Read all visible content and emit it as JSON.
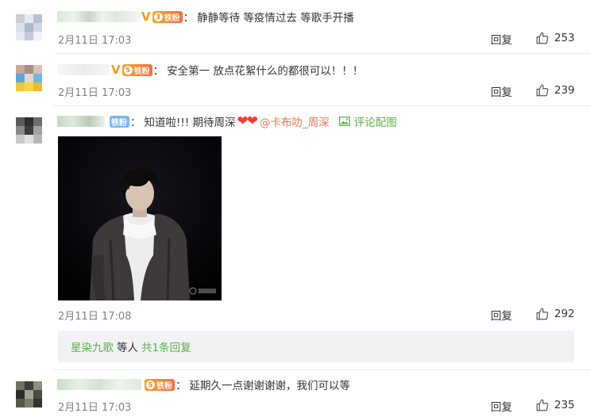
{
  "comments": [
    {
      "text": "静静等待 等疫情过去 等歌手开播",
      "date": "2月11日 17:03",
      "reply": "回复",
      "likes": "253",
      "fan_badge": "铁粉",
      "fan_level": "3"
    },
    {
      "text": "安全第一  放点花絮什么的都很可以！！！",
      "date": "2月11日 17:03",
      "reply": "回复",
      "likes": "239",
      "fan_badge": "铁粉",
      "fan_level": "5"
    },
    {
      "text": "知道啦!!!  期待周深",
      "mention": "@卡布叻_周深",
      "pic_link": "评论配图",
      "date": "2月11日 17:08",
      "reply": "回复",
      "likes": "292",
      "fan_badge": "铁粉",
      "sub_replies": {
        "name": "星染九歌",
        "others": "等人",
        "count": "共1条回复"
      }
    },
    {
      "text": "延期久一点谢谢谢谢，我们可以等",
      "date": "2月11日 17:03",
      "reply": "回复",
      "likes": "235",
      "fan_badge": "铁粉",
      "fan_level": "5"
    }
  ],
  "icons": {
    "like": "thumbs-up-icon",
    "picture": "picture-icon",
    "vip": "vip-crown-icon",
    "heart": "heart-icon"
  },
  "colors": {
    "link_green": "#5eae48",
    "mention_orange": "#eb7350",
    "vip_orange": "#f59c1a",
    "muted": "#808080"
  }
}
